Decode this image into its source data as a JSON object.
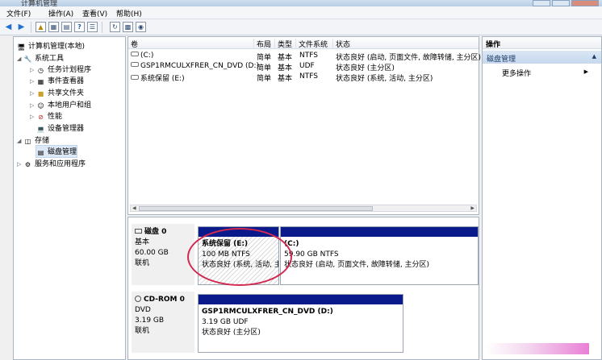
{
  "window": {
    "title": "计算机管理"
  },
  "menu": [
    "文件(F)",
    "操作(A)",
    "查看(V)",
    "帮助(H)"
  ],
  "tree": {
    "root": "计算机管理(本地)",
    "system_tools": "系统工具",
    "task_scheduler": "任务计划程序",
    "event_viewer": "事件查看器",
    "shared_folders": "共享文件夹",
    "local_users": "本地用户和组",
    "performance": "性能",
    "device_manager": "设备管理器",
    "storage": "存储",
    "disk_management": "磁盘管理",
    "services": "服务和应用程序"
  },
  "volume_list": {
    "headers": [
      "卷",
      "布局",
      "类型",
      "文件系统",
      "状态"
    ],
    "rows": [
      {
        "vol": "(C:)",
        "layout": "简单",
        "type": "基本",
        "fs": "NTFS",
        "status": "状态良好 (启动, 页面文件, 故障转储, 主分区)"
      },
      {
        "vol": "GSP1RMCULXFRER_CN_DVD (D:)",
        "layout": "简单",
        "type": "基本",
        "fs": "UDF",
        "status": "状态良好 (主分区)"
      },
      {
        "vol": "系统保留 (E:)",
        "layout": "简单",
        "type": "基本",
        "fs": "NTFS",
        "status": "状态良好 (系统, 活动, 主分区)"
      }
    ]
  },
  "disks": {
    "disk0": {
      "name": "磁盘 0",
      "type": "基本",
      "size": "60.00 GB",
      "state": "联机",
      "partitions": [
        {
          "name": "系统保留 (E:)",
          "size": "100 MB NTFS",
          "status": "状态良好 (系统, 活动, 主"
        },
        {
          "name": "(C:)",
          "size": "59.90 GB NTFS",
          "status": "状态良好 (启动, 页面文件, 故障转储, 主分区)"
        }
      ]
    },
    "cdrom0": {
      "name": "CD-ROM 0",
      "type": "DVD",
      "size": "3.19 GB",
      "state": "联机",
      "partition": {
        "name": "GSP1RMCULXFRER_CN_DVD (D:)",
        "size": "3.19 GB UDF",
        "status": "状态良好 (主分区)"
      }
    }
  },
  "actions": {
    "header": "操作",
    "section": "磁盘管理",
    "more": "更多操作"
  }
}
